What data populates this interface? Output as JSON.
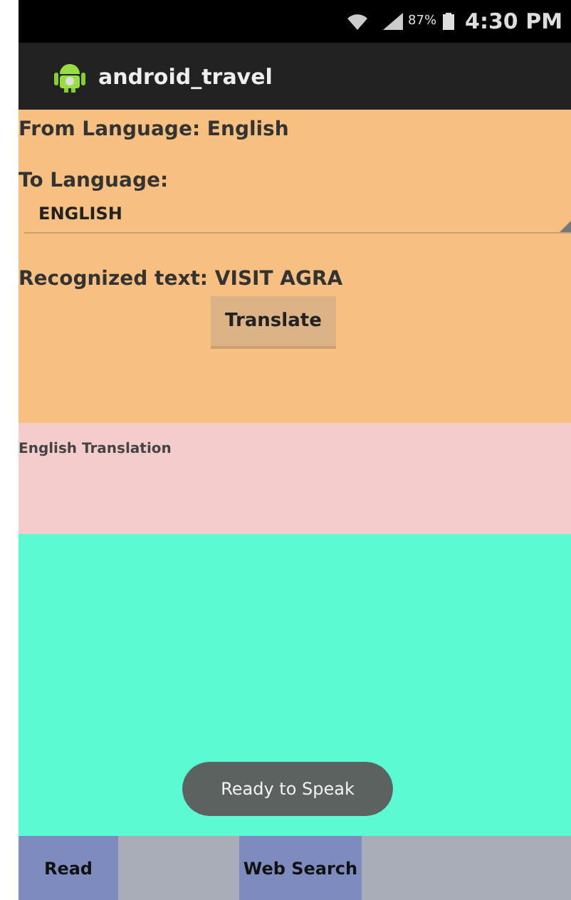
{
  "status_bar": {
    "battery": "87%",
    "time": "4:30 PM"
  },
  "action_bar": {
    "title": "android_travel"
  },
  "from_language": "From Language: English",
  "to_language_label": "To Language:",
  "to_language_spinner": {
    "value": "ENGLISH"
  },
  "recognized_text": "Recognized text: VISIT AGRA",
  "translate_button": "Translate",
  "translation_label": "English Translation",
  "toast": "Ready to Speak",
  "bottom_buttons": [
    {
      "label": "Read"
    },
    {
      "label": "Web Search"
    }
  ]
}
